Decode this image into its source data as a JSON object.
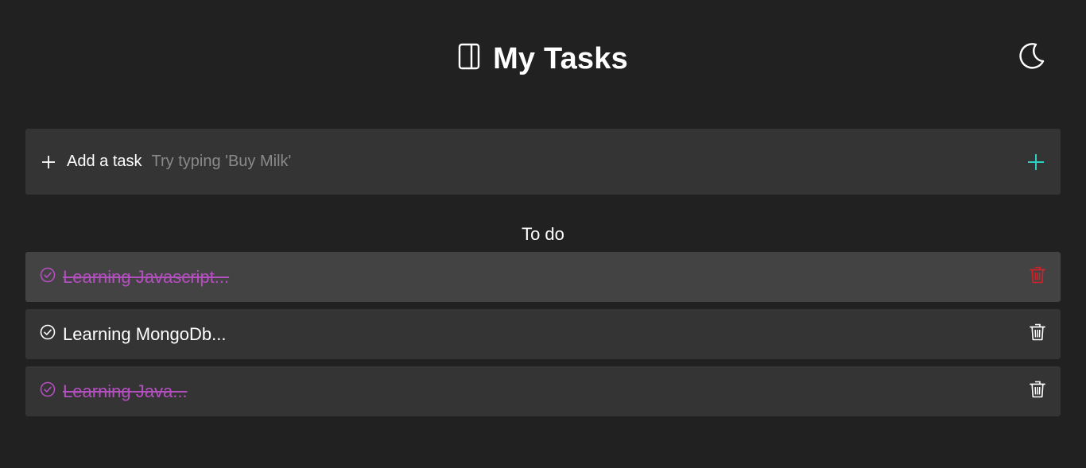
{
  "header": {
    "title": "My Tasks",
    "logo_icon": "book-icon",
    "theme_toggle_icon": "moon-icon"
  },
  "add_task": {
    "label": "Add a task",
    "placeholder": "Try typing 'Buy Milk'",
    "value": "",
    "leading_icon": "plus-icon",
    "submit_icon": "plus-icon",
    "submit_color": "#2ad1c3"
  },
  "section": {
    "title": "To do"
  },
  "tasks": [
    {
      "text": "Learning Javascript...",
      "done": true,
      "hovered": true
    },
    {
      "text": "Learning MongoDb...",
      "done": false,
      "hovered": false
    },
    {
      "text": "Learning Java...",
      "done": true,
      "hovered": false
    }
  ],
  "colors": {
    "background": "#212121",
    "card": "#343434",
    "card_hover": "#434343",
    "done_text": "#b44fc0",
    "delete_hover": "#d1232a",
    "accent": "#2ad1c3"
  }
}
